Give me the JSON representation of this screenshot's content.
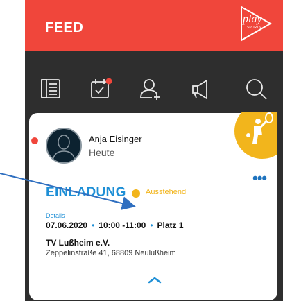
{
  "header": {
    "title": "FEED",
    "logo_text": "play",
    "logo_subtext": "SPORTS"
  },
  "iconbar": {
    "items": [
      {
        "icon": "newspaper-icon"
      },
      {
        "icon": "calendar-check-icon",
        "badge": true
      },
      {
        "icon": "add-user-icon"
      },
      {
        "icon": "megaphone-icon"
      },
      {
        "icon": "search-icon"
      }
    ]
  },
  "card": {
    "user_name": "Anja Eisinger",
    "when": "Heute",
    "sport_icon": "tennis-player-icon",
    "type": "EINLADUNG",
    "status": "Ausstehend",
    "details_label": "Details",
    "date": "07.06.2020",
    "time": "10:00 -11:00",
    "court": "Platz 1",
    "club": "TV Lußheim e.V.",
    "address": "Zeppelinstraße 41, 68809 Neulußheim"
  },
  "colors": {
    "header": "#f0463b",
    "accent": "#1e8fd6",
    "status": "#f2b51c",
    "background": "#2e2e2e"
  }
}
